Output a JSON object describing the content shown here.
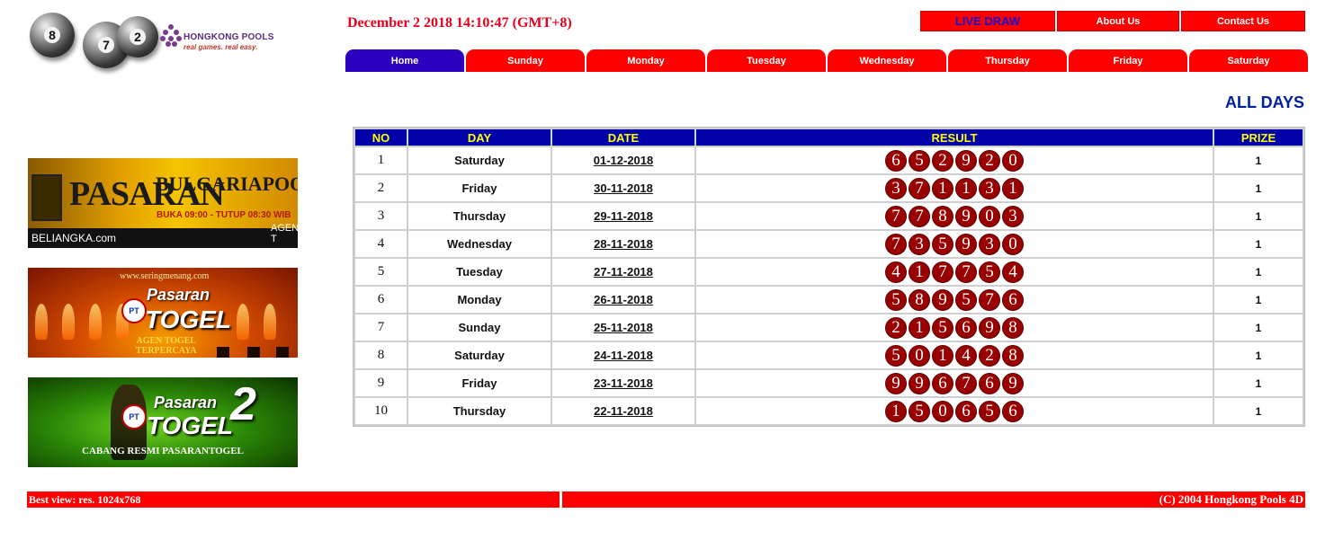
{
  "brand": {
    "ball_numbers": [
      "8",
      "7",
      "2"
    ],
    "name": "HONGKONG POOLS",
    "tagline": "real games. real easy."
  },
  "datetime": "December 2 2018 14:10:47 (GMT+8)",
  "top_nav": {
    "live_draw": "LIVE DRAW",
    "about": "About Us",
    "contact": "Contact Us"
  },
  "tabs": [
    "Home",
    "Sunday",
    "Monday",
    "Tuesday",
    "Wednesday",
    "Thursday",
    "Friday",
    "Saturday"
  ],
  "active_tab": "Home",
  "section_title": "ALL DAYS",
  "table": {
    "headers": [
      "NO",
      "DAY",
      "DATE",
      "RESULT",
      "PRIZE"
    ],
    "rows": [
      {
        "no": "1",
        "day": "Saturday",
        "date": "01-12-2018",
        "result": [
          "6",
          "5",
          "2",
          "9",
          "2",
          "0"
        ],
        "prize": "1"
      },
      {
        "no": "2",
        "day": "Friday",
        "date": "30-11-2018",
        "result": [
          "3",
          "7",
          "1",
          "1",
          "3",
          "1"
        ],
        "prize": "1"
      },
      {
        "no": "3",
        "day": "Thursday",
        "date": "29-11-2018",
        "result": [
          "7",
          "7",
          "8",
          "9",
          "0",
          "3"
        ],
        "prize": "1"
      },
      {
        "no": "4",
        "day": "Wednesday",
        "date": "28-11-2018",
        "result": [
          "7",
          "3",
          "5",
          "9",
          "3",
          "0"
        ],
        "prize": "1"
      },
      {
        "no": "5",
        "day": "Tuesday",
        "date": "27-11-2018",
        "result": [
          "4",
          "1",
          "7",
          "7",
          "5",
          "4"
        ],
        "prize": "1"
      },
      {
        "no": "6",
        "day": "Monday",
        "date": "26-11-2018",
        "result": [
          "5",
          "8",
          "9",
          "5",
          "7",
          "6"
        ],
        "prize": "1"
      },
      {
        "no": "7",
        "day": "Sunday",
        "date": "25-11-2018",
        "result": [
          "2",
          "1",
          "5",
          "6",
          "9",
          "8"
        ],
        "prize": "1"
      },
      {
        "no": "8",
        "day": "Saturday",
        "date": "24-11-2018",
        "result": [
          "5",
          "0",
          "1",
          "4",
          "2",
          "8"
        ],
        "prize": "1"
      },
      {
        "no": "9",
        "day": "Friday",
        "date": "23-11-2018",
        "result": [
          "9",
          "9",
          "6",
          "7",
          "6",
          "9"
        ],
        "prize": "1"
      },
      {
        "no": "10",
        "day": "Thursday",
        "date": "22-11-2018",
        "result": [
          "1",
          "5",
          "0",
          "6",
          "5",
          "6"
        ],
        "prize": "1"
      }
    ]
  },
  "banners": {
    "b1": {
      "title": "PASARAN",
      "market": "BULGARIAPOOLS",
      "hours": "BUKA 09:00 - TUTUP 08:30 WIB",
      "site": "BELIANGKA.com",
      "footer": "AGEN T"
    },
    "b2": {
      "site": "www.seringmenang.com",
      "title1": "Pasaran",
      "title2": "TOGEL",
      "tagline1": "AGEN TOGEL",
      "tagline2": "TERPERCAYA",
      "emblem": "PT"
    },
    "b3": {
      "title1": "Pasaran",
      "title2": "TOGEL",
      "number": "2",
      "tagline": "CABANG RESMI PASARANTOGEL",
      "emblem": "PT"
    }
  },
  "footer": {
    "left": "Best view: res. 1024x768",
    "right": "(C) 2004 Hongkong Pools 4D"
  },
  "colors": {
    "nav_red": "#ff0000",
    "active_tab": "#2c02c0",
    "header_blue": "#0000a8",
    "header_text": "#ffff00",
    "ball": "#9a0000",
    "title_blue": "#00209f",
    "datetime_red": "#e8001c"
  }
}
